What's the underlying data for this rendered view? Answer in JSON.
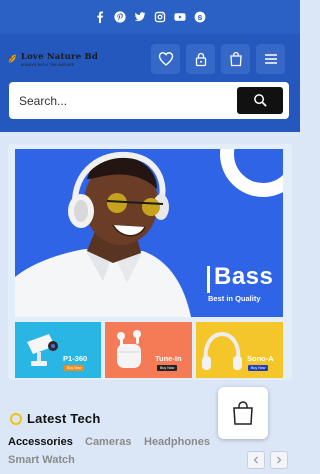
{
  "social": {
    "icons": [
      "facebook-icon",
      "pinterest-icon",
      "twitter-icon",
      "instagram-icon",
      "youtube-icon",
      "skype-icon"
    ]
  },
  "header": {
    "logo_text": "Love Nature Bd",
    "logo_tagline": "ALWAYS WITH THE NATURE",
    "buttons": [
      "heart-icon",
      "lock-icon",
      "shopping-bag-icon",
      "menu-icon"
    ]
  },
  "search": {
    "placeholder": "Search...",
    "button_icon": "search-icon"
  },
  "hero": {
    "title": "Bass",
    "subtitle": "Best in Quality"
  },
  "tiles": [
    {
      "name": "P1-360",
      "cta": "Buy Now",
      "bg": "#29b6e5",
      "btn": "#f08a1c"
    },
    {
      "name": "Tune-In",
      "cta": "Buy Now",
      "bg": "#f47b56",
      "btn": "#222222"
    },
    {
      "name": "Sono-A",
      "cta": "Buy Now",
      "bg": "#f4c62a",
      "btn": "#1d3fbf"
    }
  ],
  "latest": {
    "title": "Latest Tech",
    "tabs": [
      "Accessories",
      "Cameras",
      "Headphones",
      "Smart Watch"
    ],
    "active_tab": "Accessories"
  },
  "colors": {
    "header": "#2458bc",
    "hero": "#2f64e6",
    "accent": "#f4c20d"
  }
}
